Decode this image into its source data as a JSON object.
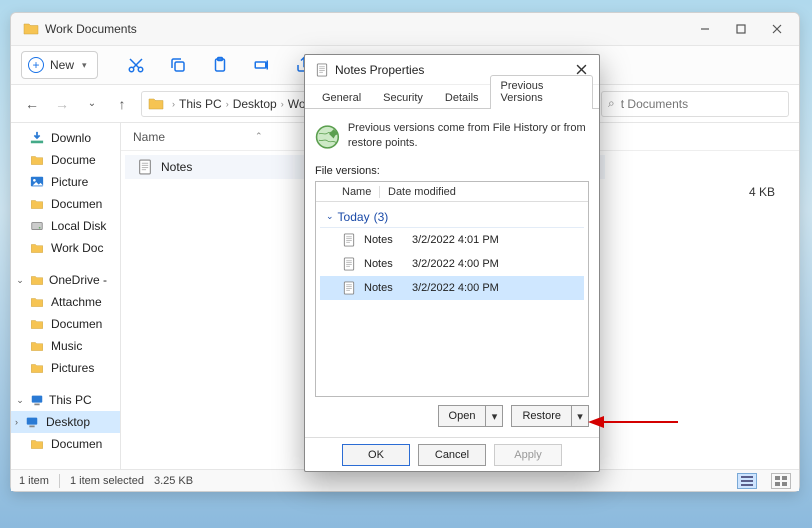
{
  "explorer": {
    "title": "Work Documents",
    "new_button": "New",
    "breadcrumb": [
      "This PC",
      "Desktop",
      "Work Do"
    ],
    "search_placeholder": "t Documents",
    "sidebar": {
      "quick": [
        "Downlo",
        "Docume",
        "Picture",
        "Documen",
        "Local Disk",
        "Work Doc"
      ],
      "onedrive_label": "OneDrive -",
      "onedrive_items": [
        "Attachme",
        "Documen",
        "Music",
        "Pictures"
      ],
      "thispc_label": "This PC",
      "thispc_items": [
        "Desktop",
        "Documen"
      ]
    },
    "columns": {
      "name": "Name"
    },
    "files": [
      {
        "name": "Notes"
      }
    ],
    "truncated_size": "4 KB",
    "status": {
      "count": "1 item",
      "selected": "1 item selected",
      "size": "3.25 KB"
    }
  },
  "dialog": {
    "title": "Notes Properties",
    "tabs": [
      "General",
      "Security",
      "Details",
      "Previous Versions"
    ],
    "active_tab": 3,
    "info": "Previous versions come from File History or from restore points.",
    "file_versions_label": "File versions:",
    "headers": {
      "name": "Name",
      "date": "Date modified"
    },
    "group": {
      "label": "Today",
      "count": "(3)"
    },
    "versions": [
      {
        "name": "Notes",
        "date": "3/2/2022 4:01 PM",
        "selected": false
      },
      {
        "name": "Notes",
        "date": "3/2/2022 4:00 PM",
        "selected": false
      },
      {
        "name": "Notes",
        "date": "3/2/2022 4:00 PM",
        "selected": true
      }
    ],
    "open_label": "Open",
    "restore_label": "Restore",
    "ok": "OK",
    "cancel": "Cancel",
    "apply": "Apply"
  }
}
